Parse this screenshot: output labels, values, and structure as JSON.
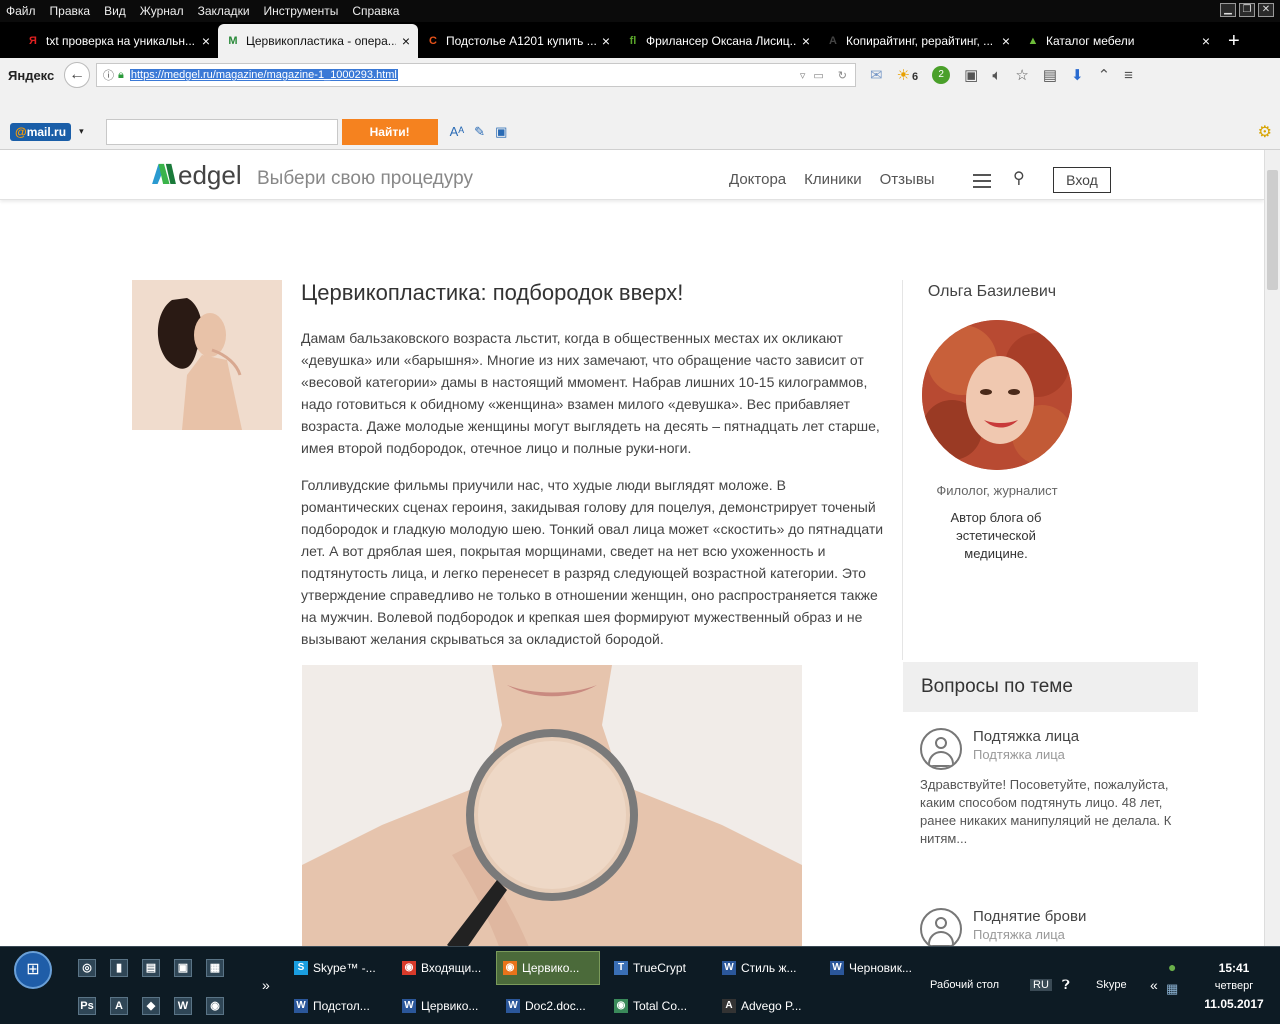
{
  "menubar": [
    "Файл",
    "Правка",
    "Вид",
    "Журнал",
    "Закладки",
    "Инструменты",
    "Справка"
  ],
  "tabs": [
    {
      "label": "txt проверка на уникальн...",
      "icon": "Я",
      "color": "#e02020",
      "active": false
    },
    {
      "label": "Цервикопластика - опера...",
      "icon": "M",
      "color": "#2a8a3a",
      "active": true
    },
    {
      "label": "Подстолье A1201 купить ...",
      "icon": "C",
      "color": "#e8531a",
      "active": false
    },
    {
      "label": "Фрилансер Оксана Лисиц...",
      "icon": "fl",
      "color": "#5aa52a",
      "active": false
    },
    {
      "label": "Копирайтинг, рерайтинг, ...",
      "icon": "A",
      "color": "#444444",
      "active": false
    },
    {
      "label": "Каталог мебели",
      "icon": "▲",
      "color": "#6dbd3a",
      "active": false
    }
  ],
  "newtab": "+",
  "browser": {
    "logo": "Яндекс",
    "url": "https://medgel.ru/magazine/magazine-1_1000293.html",
    "weather": "6",
    "badge": "2"
  },
  "mailbar": {
    "logo_at": "@",
    "logo_text": "mail.ru",
    "search_value": "",
    "find": "Найти!"
  },
  "site": {
    "logo": "edgel",
    "tagline": "Выбери свою процедуру",
    "nav": [
      "Доктора",
      "Клиники",
      "Отзывы"
    ],
    "login": "Вход"
  },
  "article": {
    "title": "Цервикопластика: подбородок вверх!",
    "p1": "Дамам бальзаковского возраста льстит, когда в общественных местах их окликают «девушка» или «барышня». Многие из них замечают, что обращение часто зависит от «весовой категории» дамы в настоящий ммомент. Набрав лишних 10-15 килограммов, надо готовиться к обидному «женщина» взамен милого «девушка». Вес прибавляет возраста. Даже молодые женщины могут выглядеть на десять – пятнадцать лет старше, имея второй подбородок, отечное лицо и полные руки-ноги.",
    "p2": "Голливудские фильмы приучили нас, что худые люди выглядят моложе. В романтических сценах героиня, закидывая голову для поцелуя, демонстрирует точеный подбородок и гладкую молодую шею. Тонкий овал лица может «скостить» до пятнадцати лет. А вот дряблая шея, покрытая морщинами, сведет на нет всю ухоженность и подтянутость лица, и легко перенесет в разряд следующей возрастной категории. Это утверждение справедливо не только в отношении женщин, оно распространяется также на мужчин. Волевой подбородок и крепкая шея формируют мужественный образ и не вызывают желания скрываться за окладистой бородой."
  },
  "author": {
    "name": "Ольга Базилевич",
    "role": "Филолог, журналист",
    "desc": "Автор блога об эстетической медицине."
  },
  "questions": {
    "heading": "Вопросы по теме",
    "items": [
      {
        "title": "Подтяжка лица",
        "sub": "Подтяжка лица",
        "body": "Здравствуйте! Посоветуйте, пожалуйста, каким способом подтянуть лицо. 48 лет, ранее никаких манипуляций не делала. К нитям..."
      },
      {
        "title": "Поднятие брови",
        "sub": "Подтяжка лица",
        "body": ""
      }
    ]
  },
  "taskbar": {
    "row1": [
      {
        "label": "Skype™ -...",
        "icon": "S",
        "color": "#1a9ee0",
        "active": false
      },
      {
        "label": "Входящи...",
        "icon": "◉",
        "color": "#d83a2a",
        "active": false
      },
      {
        "label": "Цервико...",
        "icon": "◉",
        "color": "#e8731a",
        "active": true
      },
      {
        "label": "TrueCrypt",
        "icon": "T",
        "color": "#3a6fb5",
        "active": false
      },
      {
        "label": "Стиль ж...",
        "icon": "W",
        "color": "#2b579a",
        "active": false
      },
      {
        "label": "Черновик...",
        "icon": "W",
        "color": "#2b579a",
        "active": false
      }
    ],
    "row2": [
      {
        "label": "Подстол...",
        "icon": "W",
        "color": "#2b579a"
      },
      {
        "label": "Цервико...",
        "icon": "W",
        "color": "#2b579a"
      },
      {
        "label": "Doc2.doc...",
        "icon": "W",
        "color": "#2b579a"
      },
      {
        "label": "Total Co...",
        "icon": "◉",
        "color": "#3a8a5a"
      },
      {
        "label": "Advego P...",
        "icon": "A",
        "color": "#333333"
      }
    ],
    "ql1": [
      "◎",
      "▮",
      "▤",
      "▣",
      "▦"
    ],
    "ql2": [
      "Ps",
      "A",
      "◆",
      "W",
      "◉"
    ],
    "expand": "»",
    "desktop": "Рабочий стол",
    "lang": "RU",
    "skype": "Skype",
    "arrows": "«",
    "time": "15:41",
    "day": "четверг",
    "date": "11.05.2017"
  }
}
